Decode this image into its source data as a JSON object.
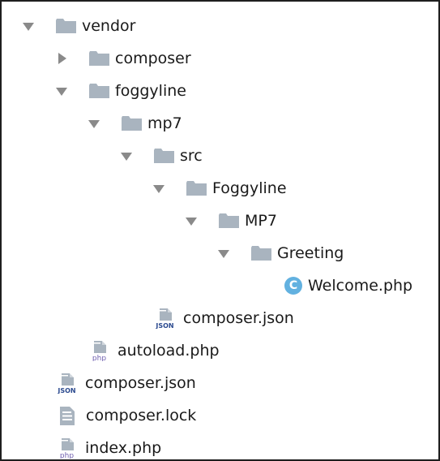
{
  "tree": [
    {
      "label": "vendor",
      "type": "folder",
      "expanded": true
    },
    {
      "label": "composer",
      "type": "folder",
      "expanded": false
    },
    {
      "label": "foggyline",
      "type": "folder",
      "expanded": true
    },
    {
      "label": "mp7",
      "type": "folder",
      "expanded": true
    },
    {
      "label": "src",
      "type": "folder",
      "expanded": true
    },
    {
      "label": "Foggyline",
      "type": "folder",
      "expanded": true
    },
    {
      "label": "MP7",
      "type": "folder",
      "expanded": true
    },
    {
      "label": "Greeting",
      "type": "folder",
      "expanded": true
    },
    {
      "label": "Welcome.php",
      "type": "class-file",
      "badge": "C"
    },
    {
      "label": "composer.json",
      "type": "json-file",
      "badge": "JSON"
    },
    {
      "label": "autoload.php",
      "type": "php-file",
      "badge": "php"
    },
    {
      "label": "composer.json",
      "type": "json-file",
      "badge": "JSON"
    },
    {
      "label": "composer.lock",
      "type": "text-file"
    },
    {
      "label": "index.php",
      "type": "php-file",
      "badge": "php"
    }
  ],
  "colors": {
    "folder": "#a9b4bf",
    "arrow": "#8a8a8a",
    "class_badge": "#62b1e0",
    "json_badge": "#2b4a8f",
    "php_badge": "#7060b0"
  }
}
